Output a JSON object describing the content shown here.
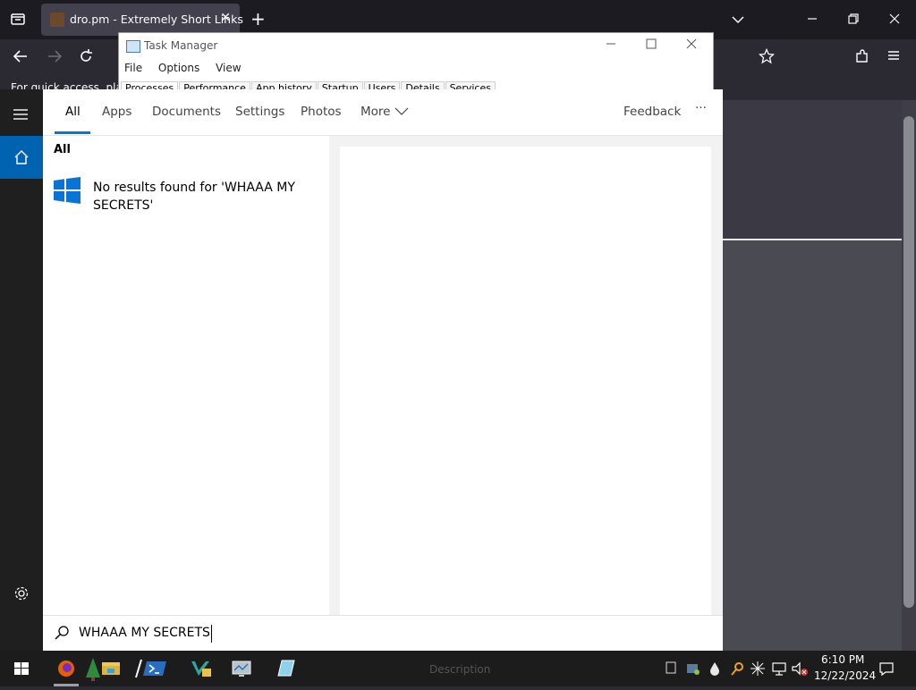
{
  "browser": {
    "tab_title": "dro.pm - Extremely Short Links",
    "tab_close": "✕",
    "new_tab": "+",
    "bookmarks_text": "For quick access, place",
    "window_controls": {
      "minimize": "—",
      "restore": "❐",
      "close": "✕",
      "list_all": "⌄"
    }
  },
  "task_manager": {
    "title": "Task Manager",
    "menu": [
      "File",
      "Options",
      "View"
    ],
    "tabs": [
      "Processes",
      "Performance",
      "App history",
      "Startup",
      "Users",
      "Details",
      "Services"
    ]
  },
  "search": {
    "tabs": [
      "All",
      "Apps",
      "Documents",
      "Settings",
      "Photos",
      "More"
    ],
    "feedback": "Feedback",
    "more_options": "···",
    "section_heading": "All",
    "result_text": "No results found for 'WHAAA MY SECRETS'",
    "query": "WHAAA MY SECRETS",
    "accent_color": "#0078d7"
  },
  "taskbar": {
    "time": "6:10 PM",
    "date": "12/22/2024",
    "hidden_window_label": "Description"
  }
}
